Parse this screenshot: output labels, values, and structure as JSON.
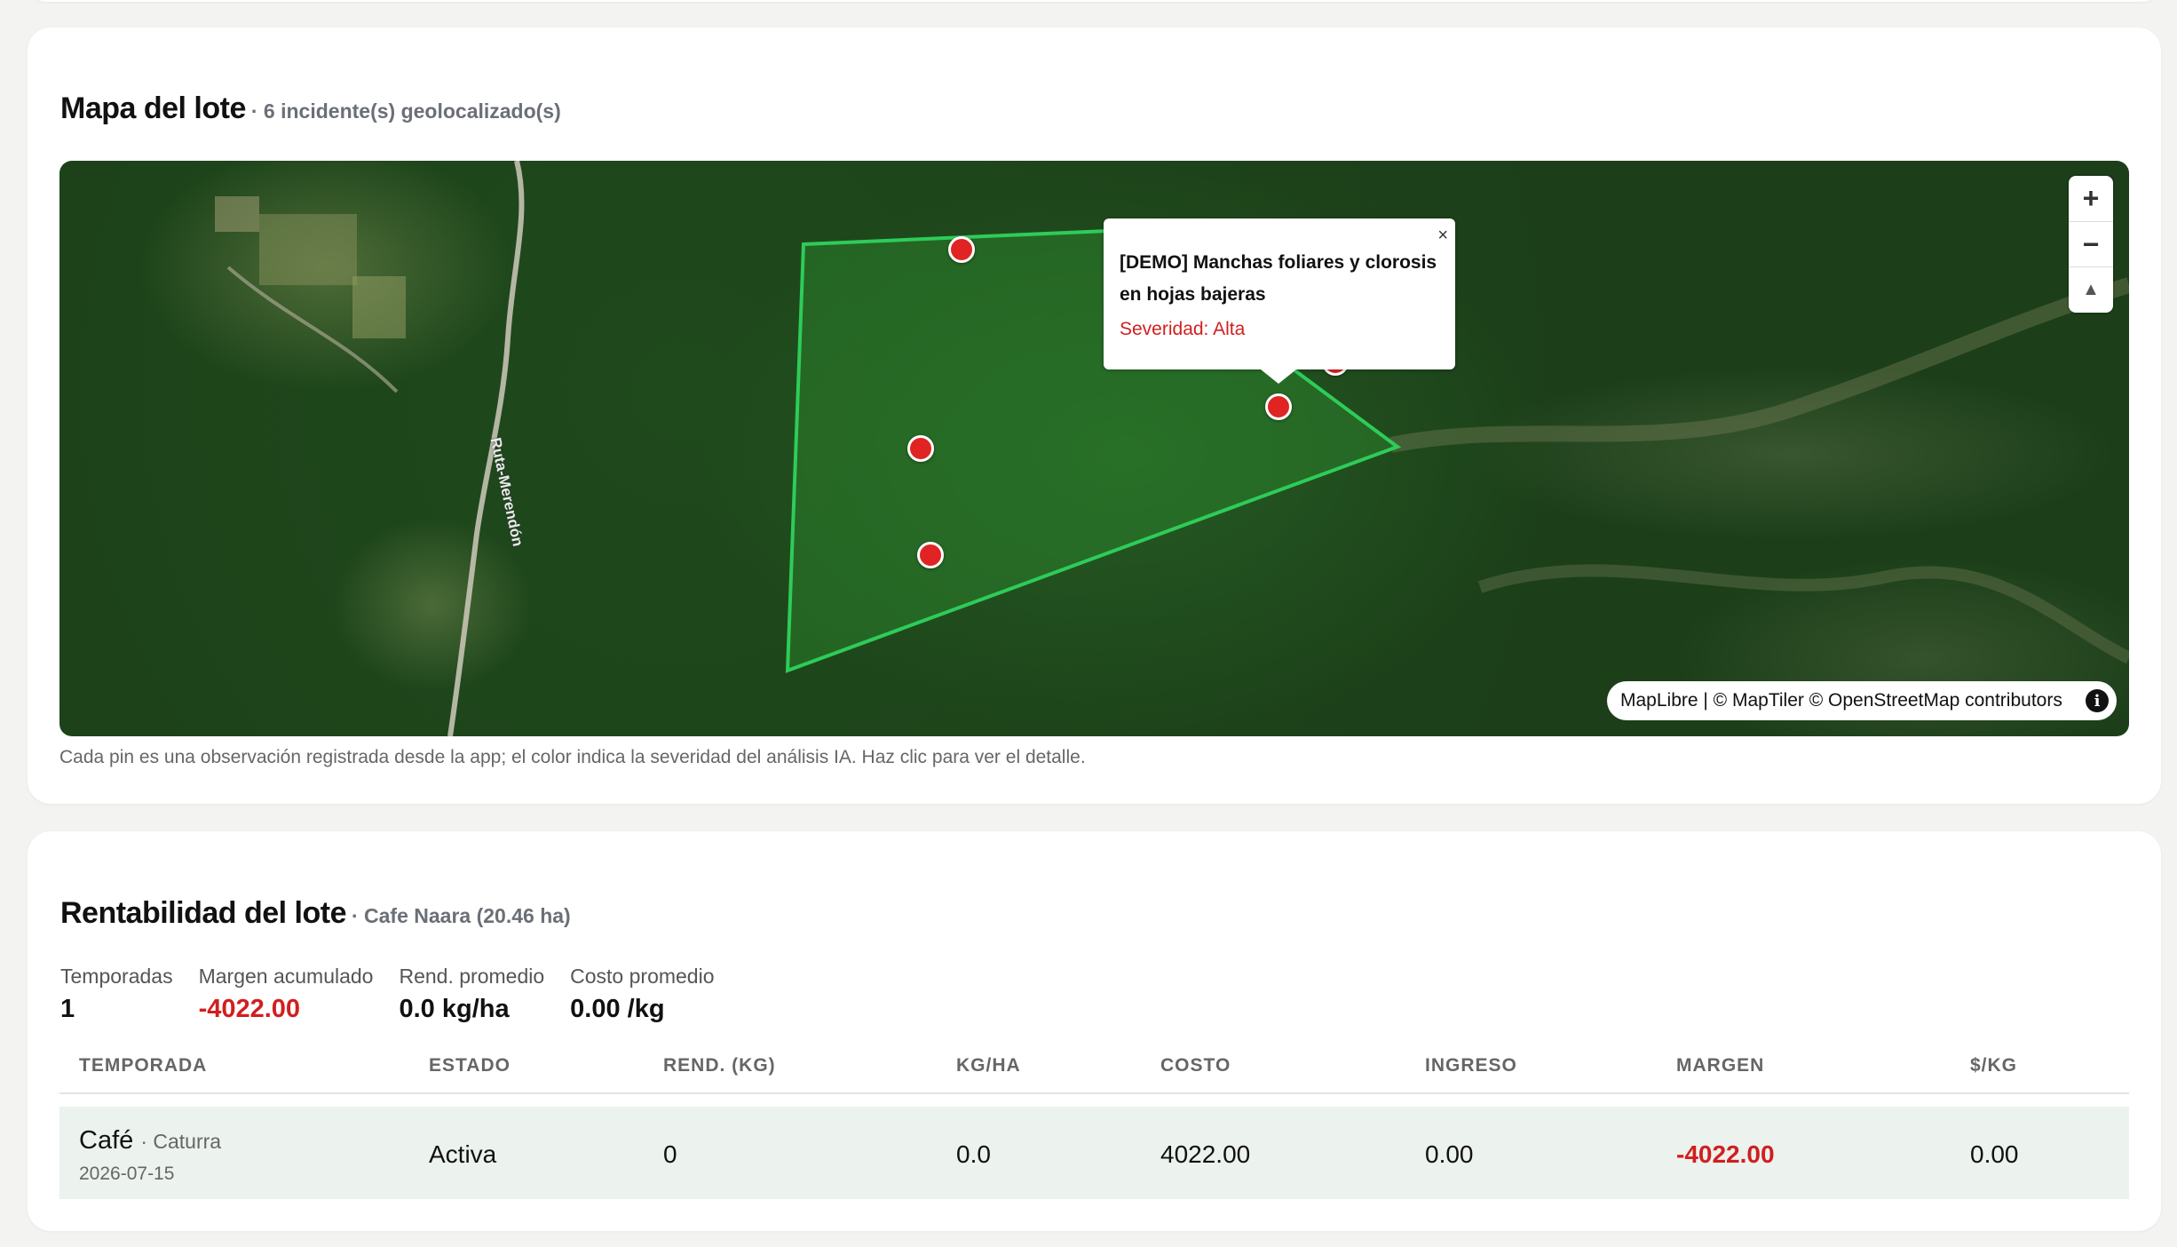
{
  "map_section": {
    "title": "Mapa del lote",
    "subtitle": "· 6 incidente(s) geolocalizado(s)",
    "road_label": "Ruta-Merendón",
    "controls": {
      "zoom_in": "+",
      "zoom_out": "−",
      "compass": "▲"
    },
    "popup": {
      "close": "×",
      "title": "[DEMO] Manchas foliares y clorosis en hojas bajeras",
      "severity": "Severidad: Alta"
    },
    "attribution": "MapLibre | © MapTiler © OpenStreetMap contributors",
    "info_icon": "i",
    "caption": "Cada pin es una observación registrada desde la app; el color indica la severidad del análisis IA. Haz clic para ver el detalle.",
    "colors": {
      "polygon": "#2ecc59",
      "pin": "#e02424",
      "severity_text": "#d11f1f"
    }
  },
  "profit_section": {
    "title": "Rentabilidad del lote",
    "subtitle": "· Cafe Naara (20.46 ha)",
    "stats": [
      {
        "label": "Temporadas",
        "value": "1"
      },
      {
        "label": "Margen acumulado",
        "value": "-4022.00"
      },
      {
        "label": "Rend. promedio",
        "value": "0.0 kg/ha"
      },
      {
        "label": "Costo promedio",
        "value": "0.00 /kg"
      }
    ],
    "table": {
      "headers": [
        "TEMPORADA",
        "ESTADO",
        "REND. (KG)",
        "KG/HA",
        "COSTO",
        "INGRESO",
        "MARGEN",
        "$/KG"
      ],
      "rows": [
        {
          "crop": "Café",
          "variety": "· Caturra",
          "date": "2026-07-15",
          "estado": "Activa",
          "rend": "0",
          "kgha": "0.0",
          "costo": "4022.00",
          "ingreso": "0.00",
          "margen": "-4022.00",
          "per_kg": "0.00"
        }
      ]
    }
  }
}
